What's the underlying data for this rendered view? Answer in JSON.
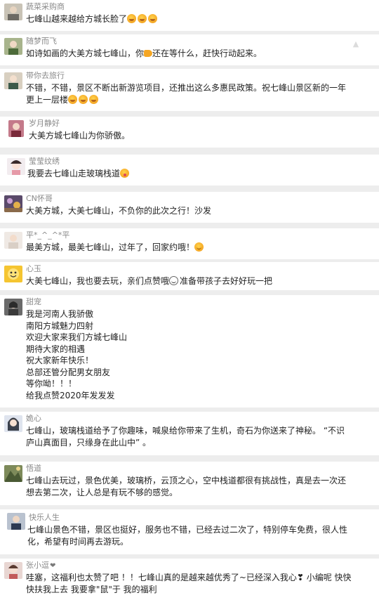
{
  "colors": {
    "background": "#ededed",
    "card": "#ffffff",
    "username": "#8a8a8a",
    "text": "#222222"
  },
  "comments": [
    {
      "username": "蔬菜采购商",
      "lines": [
        "七峰山越来越给方城长脸了"
      ],
      "emoji_trailing": [
        "cry",
        "cry",
        "cry"
      ]
    },
    {
      "username": "随梦而飞",
      "lines_parts": [
        "如诗如画的大美方城七峰山，你",
        "还在等什么，赶快行动起来。"
      ]
    },
    {
      "username": "带你去旅行",
      "lines": [
        "不错，不错，景区不断出新游览项目，还推出这么多惠民政策。祝七峰山景区新的一年",
        "更上一层楼"
      ],
      "emoji_trailing": [
        "cry",
        "cry",
        "cry"
      ]
    },
    {
      "username": "岁月静好",
      "lines": [
        "大美方城七峰山为你骄傲。"
      ]
    },
    {
      "username": "莹莹纹绣",
      "lines": [
        "我要去七峰山走玻璃栈道"
      ],
      "emoji_trailing": [
        "tongue"
      ]
    },
    {
      "username": "CN怀哥",
      "lines": [
        "大美方城，大美七峰山，不负你的此次之行！沙发"
      ]
    },
    {
      "username": "平*_^_^*平",
      "lines": [
        "最美方城，最美七峰山，过年了，回家约哦！"
      ],
      "emoji_trailing": [
        "smile"
      ]
    },
    {
      "username": "心玉",
      "lines_parts": [
        "大美七峰山，我也要去玩，亲们点赞哦",
        "准备带孩子去好好玩一把"
      ]
    },
    {
      "username": "甜宠",
      "lines": [
        "我是河南人我骄傲",
        "南阳方城魅力四射",
        "欢迎大家来我们方城七峰山",
        "期待大家的相遇",
        "祝大家新年快乐！",
        "总部还管分配男女朋友",
        "等你呦！！！",
        "给我点赞2020年发发发"
      ]
    },
    {
      "username": "姽心",
      "lines": [
        "七峰山，玻璃栈道给予了你趣味，喊泉给你带来了生机，奇石为你送来了神秘。 “不识",
        "庐山真面目，只缘身在此山中” 。"
      ]
    },
    {
      "username": "悟道",
      "lines": [
        "七峰山去玩过，景色优美，玻璃桥，云顶之心，空中栈道都很有挑战性，真是去一次还",
        "想去第二次，让人总是有玩不够的感觉。"
      ]
    },
    {
      "username": "快乐人生",
      "lines": [
        "七峰山景色不错，景区也挺好，服务也不错，已经去过二次了，特别停车免费，很人性",
        "化，希望有时间再去游玩。"
      ]
    },
    {
      "username": "张小逗",
      "lines": [
        "哇塞，这福利也太赞了吧 ！！七峰山真的是越来越优秀了~已经深入我心❣ 小编呢 快快",
        "快扶我上去 我要拿\"鼠\"于 我的福利"
      ]
    }
  ]
}
